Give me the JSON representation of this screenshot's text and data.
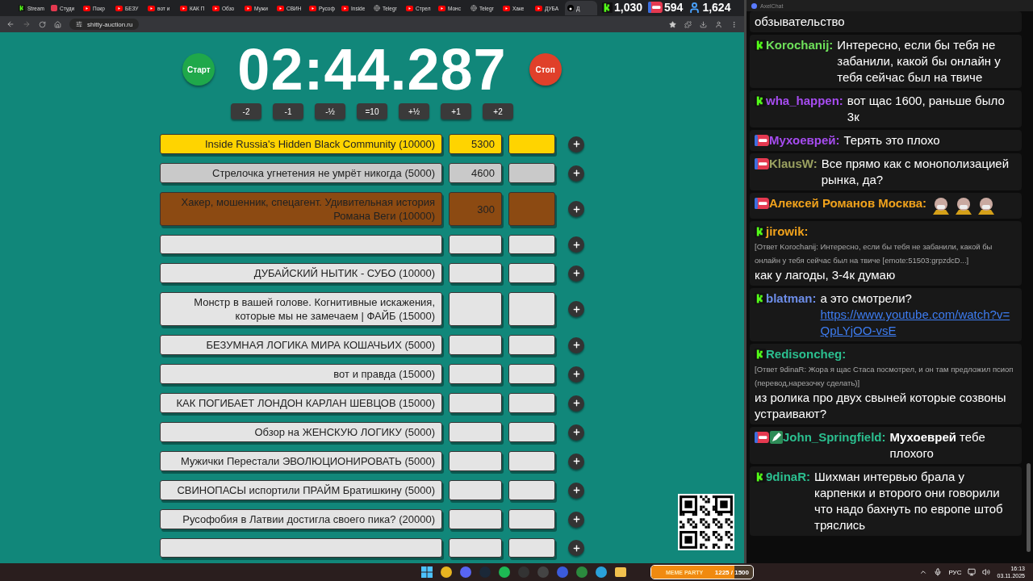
{
  "browser": {
    "tabs": [
      {
        "label": "Stream",
        "kind": "kick",
        "selected": false
      },
      {
        "label": "Студи",
        "kind": "studio",
        "selected": false
      },
      {
        "label": "Покр",
        "kind": "youtube",
        "selected": false
      },
      {
        "label": "БЕЗУ",
        "kind": "youtube",
        "selected": false
      },
      {
        "label": "вот и",
        "kind": "youtube",
        "selected": false
      },
      {
        "label": "КАК П",
        "kind": "youtube",
        "selected": false
      },
      {
        "label": "Обзо",
        "kind": "youtube",
        "selected": false
      },
      {
        "label": "Мужи",
        "kind": "youtube",
        "selected": false
      },
      {
        "label": "СВИН",
        "kind": "youtube",
        "selected": false
      },
      {
        "label": "Русоф",
        "kind": "youtube",
        "selected": false
      },
      {
        "label": "Inside",
        "kind": "youtube",
        "selected": false
      },
      {
        "label": "Telegr",
        "kind": "globe",
        "selected": false
      },
      {
        "label": "Стрел",
        "kind": "youtube",
        "selected": false
      },
      {
        "label": "Монс",
        "kind": "youtube",
        "selected": false
      },
      {
        "label": "Telegr",
        "kind": "globe",
        "selected": false
      },
      {
        "label": "Хаке",
        "kind": "youtube",
        "selected": false
      },
      {
        "label": "ДУБА",
        "kind": "youtube",
        "selected": false
      },
      {
        "label": "Д",
        "kind": "tiktok",
        "selected": true
      }
    ],
    "address": "shitty-auction.ru"
  },
  "stream_stats": [
    {
      "kind": "kick",
      "value": "1,030"
    },
    {
      "kind": "live",
      "value": "594"
    },
    {
      "kind": "viewers",
      "value": "1,624"
    }
  ],
  "auction": {
    "start_button": "Старт",
    "timer": "02:44.287",
    "stop_button": "Стоп",
    "time_buttons": [
      "-2",
      "-1",
      "-½",
      "=10",
      "+½",
      "+1",
      "+2"
    ],
    "lots": [
      {
        "name": "Inside Russia's Hidden Black Community (10000)",
        "amount": "5300",
        "color": "#ffd400"
      },
      {
        "name": "Стрелочка угнетения не умрёт никогда (5000)",
        "amount": "4600",
        "color": "#c9c9c9"
      },
      {
        "name": "Хакер, мошенник, спецагент. Удивительная история Романа Веги (10000)",
        "amount": "300",
        "color": "#8c4a12"
      },
      {
        "color": "#e4e4e4"
      },
      {
        "name": "ДУБАЙСКИЙ НЫТИК - СУБО (10000)",
        "color": "#e4e4e4"
      },
      {
        "name": "Монстр в вашей голове. Когнитивные искажения, которые мы не замечаем | ФАЙБ (15000)",
        "color": "#e4e4e4"
      },
      {
        "name": "БЕЗУМНАЯ ЛОГИКА МИРА КОШАЧЬИХ (5000)",
        "color": "#e4e4e4"
      },
      {
        "name": "вот и правда (15000)",
        "color": "#e4e4e4"
      },
      {
        "name": "КАК ПОГИБАЕТ ЛОНДОН КАРЛАН ШЕВЦОВ (15000)",
        "color": "#e4e4e4"
      },
      {
        "name": "Обзор на ЖЕНСКУЮ ЛОГИКУ (5000)",
        "color": "#e4e4e4"
      },
      {
        "name": "Мужички Перестали ЭВОЛЮЦИОНИРОВАТЬ (5000)",
        "color": "#e4e4e4"
      },
      {
        "name": "СВИНОПАСЫ испортили ПРАЙМ Братишкину (5000)",
        "color": "#e4e4e4"
      },
      {
        "name": "Русофобия в Латвии достигла своего пика? (20000)",
        "color": "#e4e4e4"
      },
      {
        "color": "#e4e4e4"
      }
    ]
  },
  "chat": {
    "title": "AxelChat",
    "messages": [
      {
        "text": "обзывательство"
      },
      {
        "badges": [
          {
            "kind": "kick"
          }
        ],
        "author": "Korochanij:",
        "color": "#6ee05a",
        "text": "Интересно, если бы тебя не забанили, какой бы онлайн у тебя сейчас был на твиче"
      },
      {
        "badges": [
          {
            "kind": "kick"
          }
        ],
        "author": "wha_happen:",
        "color": "#a64cf0",
        "text": "вот щас 1600, раньше было 3к"
      },
      {
        "badges": [
          {
            "kind": "live"
          }
        ],
        "author": "Мухоеврей:",
        "color": "#a64cf0",
        "text": "Терять это плохо"
      },
      {
        "badges": [
          {
            "kind": "live"
          }
        ],
        "author": "KlausW:",
        "color": "#9aa060",
        "text": "Все прямо как с монополизацией рынка, да?"
      },
      {
        "badges": [
          {
            "kind": "live"
          }
        ],
        "author": "Алексей Романов Москва:",
        "color": "#f0a21c",
        "emotes": [
          {
            "kind": "emote"
          },
          {
            "kind": "emote"
          },
          {
            "kind": "emote"
          }
        ]
      },
      {
        "badges": [
          {
            "kind": "kick"
          }
        ],
        "author": "jirowik:",
        "color": "#f0a21c",
        "reply": "[Ответ Korochanij: Интересно, если бы тебя не забанили, какой бы онлайн у тебя сейчас был на твиче [emote:51503:grpzdcD...]",
        "text": "как у лагоды, 3-4к думаю"
      },
      {
        "badges": [
          {
            "kind": "kick"
          }
        ],
        "author": "blatman:",
        "color": "#6d8de8",
        "text": "а это смотрели?",
        "link": "https://www.youtube.com/watch?v=QpLYjOO-vsE"
      },
      {
        "badges": [
          {
            "kind": "kick"
          }
        ],
        "author": "Redisoncheg:",
        "color": "#2bbf8f",
        "reply": "[Ответ 9dinaR: Жора я щас Стаса посмотрел, и он там предложил псиоп (перевод,нарезочку сделать)]",
        "text": "из ролика про двух свыней которые созвоны устраивают?"
      },
      {
        "badges": [
          {
            "kind": "live"
          },
          {
            "kind": "pencil"
          }
        ],
        "author": "John_Springfield:",
        "color": "#2bbf8f",
        "text": "**Мухоеврей** тебе плохого"
      },
      {
        "badges": [
          {
            "kind": "kick"
          }
        ],
        "author": "9dinaR:",
        "color": "#2bbf8f",
        "text": "Шихман интервью брала у карпенки и второго они говорили что надо бахнуть по европе штоб тряслись"
      }
    ]
  },
  "taskbar": {
    "apps": [
      {
        "kind": "start"
      },
      {
        "kind": "chrome"
      },
      {
        "kind": "discord"
      },
      {
        "kind": "steam"
      },
      {
        "kind": "spotify"
      },
      {
        "kind": "obs"
      },
      {
        "kind": "camera"
      },
      {
        "kind": "player"
      },
      {
        "kind": "snip"
      },
      {
        "kind": "telegram"
      },
      {
        "kind": "folder"
      }
    ],
    "widget": {
      "title": "MEME PARTY",
      "progress": "1225 / 1500",
      "level": 0.82
    },
    "language": "РУС",
    "time": "16:13",
    "date": "03.11.2025"
  }
}
